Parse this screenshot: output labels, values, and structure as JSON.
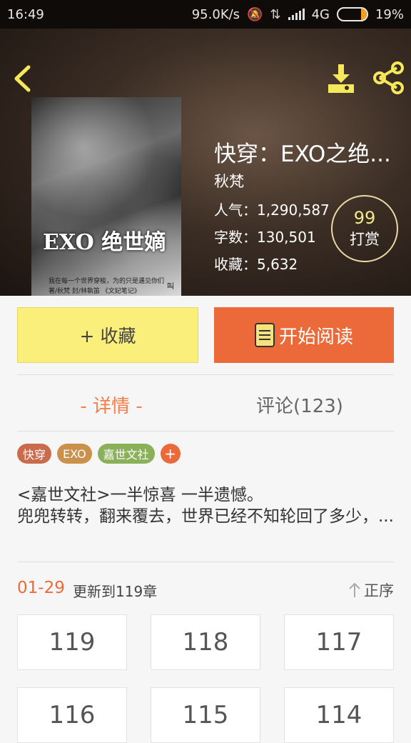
{
  "status_bar": {
    "time": "16:49",
    "net_speed": "95.0K/s",
    "network": "4G",
    "battery": "19%",
    "battery_level": 0.19
  },
  "book": {
    "title": "快穿：EXO之绝...",
    "author": "秋梵",
    "popularity": "人气：1,290,587",
    "word_count": "字数：130,501",
    "favorites": "收藏：5,632",
    "cover": {
      "title": "EXO 绝世嫡",
      "subtitle": "我在每一个世界穿梭，为的只是遇见你们",
      "credits": "著/秋梵  封/林執笛  《文妃笔记》",
      "mark": "叫"
    }
  },
  "reward": {
    "count": "99",
    "label": "打赏"
  },
  "actions": {
    "favorite_label": "+ 收藏",
    "read_label": "开始阅读"
  },
  "tabs": {
    "detail": "- 详情 -",
    "comments": "评论(123)"
  },
  "tags": [
    {
      "label": "快穿",
      "color": "#c96b4c"
    },
    {
      "label": "EXO",
      "color": "#c9914c"
    },
    {
      "label": "嘉世文社",
      "color": "#8bb05a"
    }
  ],
  "tag_add": "+",
  "description": "<嘉世文社>一半惊喜 一半遗憾。\n兜兜转转，翻来覆去，世界已经不知轮回了多少，...",
  "update": {
    "date": "01-29",
    "text": "更新到119章",
    "sort_label": "正序"
  },
  "chapters": [
    "119",
    "118",
    "117",
    "116",
    "115",
    "114"
  ],
  "colors": {
    "accent": "#ec6a3a",
    "favorite_bg": "#fbef7b",
    "icon_yellow": "#f5e85a"
  }
}
